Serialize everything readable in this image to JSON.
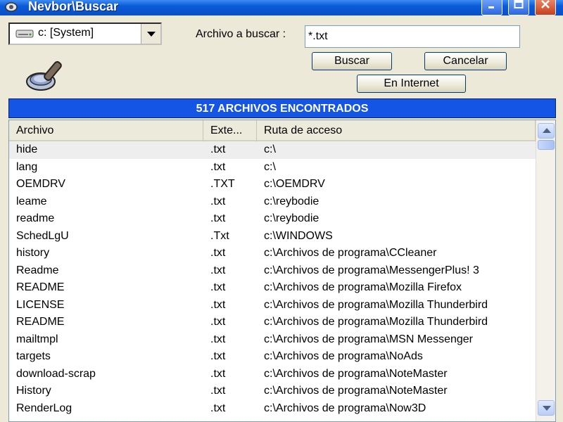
{
  "window": {
    "title": "Nevbor\\Buscar"
  },
  "drive": {
    "selected": "c: [System]"
  },
  "search": {
    "label": "Archivo a buscar :",
    "value": "*.txt"
  },
  "buttons": {
    "search": "Buscar",
    "cancel": "Cancelar",
    "internet": "En Internet"
  },
  "results": {
    "header": "517  ARCHIVOS ENCONTRADOS",
    "columns": [
      "Archivo",
      "Exte...",
      "Ruta de acceso"
    ],
    "rows": [
      {
        "name": "hide",
        "ext": ".txt",
        "path": "c:\\"
      },
      {
        "name": "lang",
        "ext": ".txt",
        "path": "c:\\"
      },
      {
        "name": "OEMDRV",
        "ext": ".TXT",
        "path": "c:\\OEMDRV"
      },
      {
        "name": "leame",
        "ext": ".txt",
        "path": "c:\\reybodie"
      },
      {
        "name": "readme",
        "ext": ".txt",
        "path": "c:\\reybodie"
      },
      {
        "name": "SchedLgU",
        "ext": ".Txt",
        "path": "c:\\WINDOWS"
      },
      {
        "name": "history",
        "ext": ".txt",
        "path": "c:\\Archivos de programa\\CCleaner"
      },
      {
        "name": "Readme",
        "ext": ".txt",
        "path": "c:\\Archivos de programa\\MessengerPlus! 3"
      },
      {
        "name": "README",
        "ext": ".txt",
        "path": "c:\\Archivos de programa\\Mozilla Firefox"
      },
      {
        "name": "LICENSE",
        "ext": ".txt",
        "path": "c:\\Archivos de programa\\Mozilla Thunderbird"
      },
      {
        "name": "README",
        "ext": ".txt",
        "path": "c:\\Archivos de programa\\Mozilla Thunderbird"
      },
      {
        "name": "mailtmpl",
        "ext": ".txt",
        "path": "c:\\Archivos de programa\\MSN Messenger"
      },
      {
        "name": "targets",
        "ext": ".txt",
        "path": "c:\\Archivos de programa\\NoAds"
      },
      {
        "name": "download-scrap",
        "ext": ".txt",
        "path": "c:\\Archivos de programa\\NoteMaster"
      },
      {
        "name": "History",
        "ext": ".txt",
        "path": "c:\\Archivos de programa\\NoteMaster"
      },
      {
        "name": "RenderLog",
        "ext": ".txt",
        "path": "c:\\Archivos de programa\\Now3D"
      }
    ]
  },
  "icons": {
    "app": "app-icon",
    "drive": "hard-drive-icon",
    "magnifier": "magnifier-icon",
    "dropdown": "chevron-down-icon",
    "scroll_up": "scroll-up-icon",
    "scroll_down": "scroll-down-icon"
  },
  "colors": {
    "titlebar": "#0a5ad8",
    "results_header": "#1555e6",
    "close_button": "#c8401c"
  }
}
